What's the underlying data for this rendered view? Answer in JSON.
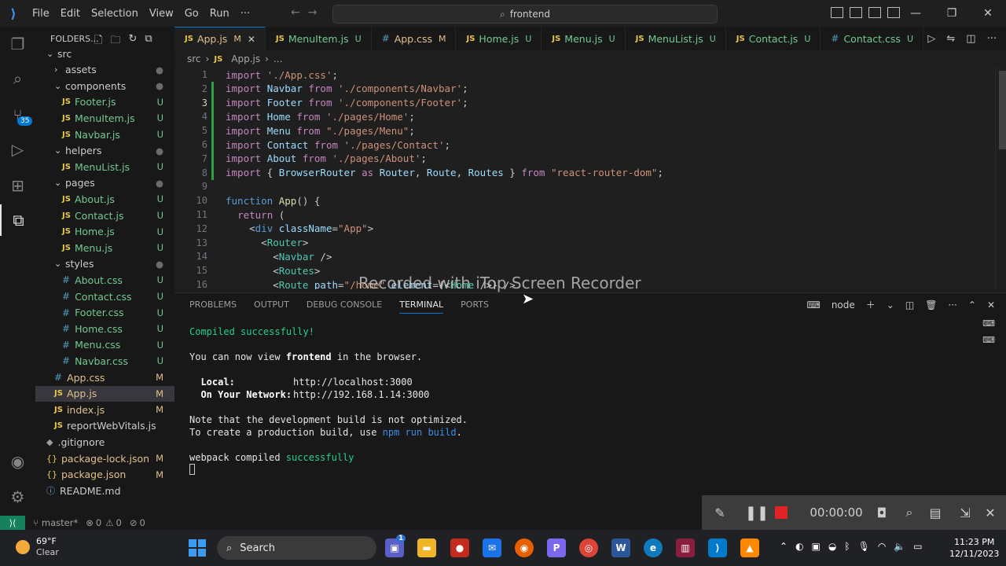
{
  "titlebar": {
    "menus": [
      "File",
      "Edit",
      "Selection",
      "View",
      "Go",
      "Run",
      "···"
    ],
    "command_center": "frontend",
    "window_controls": [
      "—",
      "❐",
      "✕"
    ]
  },
  "activity_bar": {
    "icons": [
      "explorer-icon",
      "search-icon",
      "source-control-icon",
      "run-debug-icon",
      "extensions-icon",
      "remote-explorer-icon",
      "accounts-icon",
      "manage-icon"
    ],
    "source_control_badge": "35"
  },
  "sidebar": {
    "header": "FOLDERS...",
    "items": [
      {
        "label": "src",
        "type": "folder",
        "status": "",
        "indent": 0
      },
      {
        "label": "assets",
        "type": "folder-closed",
        "status": "dot",
        "indent": 1
      },
      {
        "label": "components",
        "type": "folder",
        "status": "dot",
        "indent": 1
      },
      {
        "label": "Footer.js",
        "type": "js",
        "status": "U",
        "indent": 2
      },
      {
        "label": "MenuItem.js",
        "type": "js",
        "status": "U",
        "indent": 2
      },
      {
        "label": "Navbar.js",
        "type": "js",
        "status": "U",
        "indent": 2
      },
      {
        "label": "helpers",
        "type": "folder",
        "status": "dot",
        "indent": 1
      },
      {
        "label": "MenuList.js",
        "type": "js",
        "status": "U",
        "indent": 2
      },
      {
        "label": "pages",
        "type": "folder",
        "status": "dot",
        "indent": 1
      },
      {
        "label": "About.js",
        "type": "js",
        "status": "U",
        "indent": 2
      },
      {
        "label": "Contact.js",
        "type": "js",
        "status": "U",
        "indent": 2
      },
      {
        "label": "Home.js",
        "type": "js",
        "status": "U",
        "indent": 2
      },
      {
        "label": "Menu.js",
        "type": "js",
        "status": "U",
        "indent": 2
      },
      {
        "label": "styles",
        "type": "folder",
        "status": "dot",
        "indent": 1
      },
      {
        "label": "About.css",
        "type": "css",
        "status": "U",
        "indent": 2
      },
      {
        "label": "Contact.css",
        "type": "css",
        "status": "U",
        "indent": 2
      },
      {
        "label": "Footer.css",
        "type": "css",
        "status": "U",
        "indent": 2
      },
      {
        "label": "Home.css",
        "type": "css",
        "status": "U",
        "indent": 2
      },
      {
        "label": "Menu.css",
        "type": "css",
        "status": "U",
        "indent": 2
      },
      {
        "label": "Navbar.css",
        "type": "css",
        "status": "U",
        "indent": 2
      },
      {
        "label": "App.css",
        "type": "css",
        "status": "M",
        "indent": 1
      },
      {
        "label": "App.js",
        "type": "js",
        "status": "M",
        "indent": 1,
        "selected": true
      },
      {
        "label": "index.js",
        "type": "js",
        "status": "M",
        "indent": 1
      },
      {
        "label": "reportWebVitals.js",
        "type": "js",
        "status": "",
        "indent": 1
      },
      {
        "label": ".gitignore",
        "type": "git",
        "status": "",
        "indent": 0
      },
      {
        "label": "package-lock.json",
        "type": "json",
        "status": "M",
        "indent": 0
      },
      {
        "label": "package.json",
        "type": "json",
        "status": "M",
        "indent": 0
      },
      {
        "label": "README.md",
        "type": "md",
        "status": "",
        "indent": 0
      }
    ]
  },
  "tabs": [
    {
      "label": "App.js",
      "kind": "js",
      "status": "M",
      "active": true,
      "close": "✕"
    },
    {
      "label": "MenuItem.js",
      "kind": "js",
      "status": "U"
    },
    {
      "label": "App.css",
      "kind": "css",
      "status": "M"
    },
    {
      "label": "Home.js",
      "kind": "js",
      "status": "U"
    },
    {
      "label": "Menu.js",
      "kind": "js",
      "status": "U"
    },
    {
      "label": "MenuList.js",
      "kind": "js",
      "status": "U"
    },
    {
      "label": "Contact.js",
      "kind": "js",
      "status": "U"
    },
    {
      "label": "Contact.css",
      "kind": "css",
      "status": "U"
    }
  ],
  "breadcrumb": [
    "src",
    "App.js",
    "..."
  ],
  "editor": {
    "current_line": 3,
    "lines": [
      [
        [
          "k",
          "import"
        ],
        [
          "p",
          " "
        ],
        [
          "s",
          "'./App.css'"
        ],
        [
          "p",
          ";"
        ]
      ],
      [
        [
          "k",
          "import"
        ],
        [
          "p",
          " "
        ],
        [
          "v",
          "Navbar"
        ],
        [
          "p",
          " "
        ],
        [
          "k",
          "from"
        ],
        [
          "p",
          " "
        ],
        [
          "s",
          "'./components/Navbar'"
        ],
        [
          "p",
          ";"
        ]
      ],
      [
        [
          "k",
          "import"
        ],
        [
          "p",
          " "
        ],
        [
          "v",
          "Footer"
        ],
        [
          "p",
          " "
        ],
        [
          "k",
          "from"
        ],
        [
          "p",
          " "
        ],
        [
          "s",
          "'./components/Footer'"
        ],
        [
          "p",
          ";"
        ]
      ],
      [
        [
          "k",
          "import"
        ],
        [
          "p",
          " "
        ],
        [
          "v",
          "Home"
        ],
        [
          "p",
          " "
        ],
        [
          "k",
          "from"
        ],
        [
          "p",
          " "
        ],
        [
          "s",
          "'./pages/Home'"
        ],
        [
          "p",
          ";"
        ]
      ],
      [
        [
          "k",
          "import"
        ],
        [
          "p",
          " "
        ],
        [
          "v",
          "Menu"
        ],
        [
          "p",
          " "
        ],
        [
          "k",
          "from"
        ],
        [
          "p",
          " "
        ],
        [
          "s",
          "\"./pages/Menu\""
        ],
        [
          "p",
          ";"
        ]
      ],
      [
        [
          "k",
          "import"
        ],
        [
          "p",
          " "
        ],
        [
          "v",
          "Contact"
        ],
        [
          "p",
          " "
        ],
        [
          "k",
          "from"
        ],
        [
          "p",
          " "
        ],
        [
          "s",
          "'./pages/Contact'"
        ],
        [
          "p",
          ";"
        ]
      ],
      [
        [
          "k",
          "import"
        ],
        [
          "p",
          " "
        ],
        [
          "v",
          "About"
        ],
        [
          "p",
          " "
        ],
        [
          "k",
          "from"
        ],
        [
          "p",
          " "
        ],
        [
          "s",
          "'./pages/About'"
        ],
        [
          "p",
          ";"
        ]
      ],
      [
        [
          "k",
          "import"
        ],
        [
          "p",
          " { "
        ],
        [
          "v",
          "BrowserRouter"
        ],
        [
          "p",
          " "
        ],
        [
          "k",
          "as"
        ],
        [
          "p",
          " "
        ],
        [
          "v",
          "Router"
        ],
        [
          "p",
          ", "
        ],
        [
          "v",
          "Route"
        ],
        [
          "p",
          ", "
        ],
        [
          "v",
          "Routes"
        ],
        [
          "p",
          " } "
        ],
        [
          "k",
          "from"
        ],
        [
          "p",
          " "
        ],
        [
          "s",
          "\"react-router-dom\""
        ],
        [
          "p",
          ";"
        ]
      ],
      [],
      [
        [
          "t",
          "function"
        ],
        [
          "p",
          " "
        ],
        [
          "f",
          "App"
        ],
        [
          "p",
          "() {"
        ]
      ],
      [
        [
          "p",
          "  "
        ],
        [
          "k",
          "return"
        ],
        [
          "p",
          " ("
        ]
      ],
      [
        [
          "p",
          "    <"
        ],
        [
          "t",
          "div"
        ],
        [
          "p",
          " "
        ],
        [
          "v",
          "className"
        ],
        [
          "p",
          "="
        ],
        [
          "s",
          "\"App\""
        ],
        [
          "p",
          ">"
        ]
      ],
      [
        [
          "p",
          "      <"
        ],
        [
          "tg",
          "Router"
        ],
        [
          "p",
          ">"
        ]
      ],
      [
        [
          "p",
          "        <"
        ],
        [
          "tg",
          "Navbar"
        ],
        [
          "p",
          " />"
        ]
      ],
      [
        [
          "p",
          "        <"
        ],
        [
          "tg",
          "Routes"
        ],
        [
          "p",
          ">"
        ]
      ],
      [
        [
          "p",
          "        <"
        ],
        [
          "tg",
          "Route"
        ],
        [
          "p",
          " "
        ],
        [
          "v",
          "path"
        ],
        [
          "p",
          "="
        ],
        [
          "s",
          "\"/home\""
        ],
        [
          "p",
          " "
        ],
        [
          "v",
          "element"
        ],
        [
          "p",
          "={<"
        ],
        [
          "tg",
          "Home"
        ],
        [
          "p",
          " />} />"
        ]
      ]
    ],
    "modified_gutter": [
      2,
      3,
      4,
      5,
      6,
      7,
      8
    ]
  },
  "watermark": "Recorded with iTop Screen Recorder",
  "panel": {
    "tabs": [
      "PROBLEMS",
      "OUTPUT",
      "DEBUG CONSOLE",
      "TERMINAL",
      "PORTS"
    ],
    "active_tab": "TERMINAL",
    "terminal_name": "node",
    "terminal": {
      "compiled": "Compiled successfully!",
      "view_prefix": "You can now view ",
      "view_app": "frontend",
      "view_suffix": " in the browser.",
      "local_label": "  Local:",
      "local_url": "http://localhost:3000",
      "network_label": "  On Your Network:",
      "network_url": "http://192.168.1.14:3000",
      "note1": "Note that the development build is not optimized.",
      "note2_prefix": "To create a production build, use ",
      "note2_cmd": "npm run build",
      "note2_suffix": ".",
      "webpack_prefix": "webpack compiled ",
      "webpack_status": "successfully"
    }
  },
  "statusbar": {
    "branch": "master*",
    "errors": "0",
    "warnings": "0",
    "ports": "0"
  },
  "recorder": {
    "time": "00:00:00"
  },
  "taskbar": {
    "weather_temp": "69°F",
    "weather_desc": "Clear",
    "search_placeholder": "Search",
    "chat_badge": "1",
    "time": "11:23 PM",
    "date": "12/11/2023"
  },
  "colors": {
    "accent": "#0078d4",
    "untracked": "#73c991",
    "modified": "#e2c08d",
    "terminal_green": "#23d18b",
    "terminal_blue": "#3b8eea"
  }
}
